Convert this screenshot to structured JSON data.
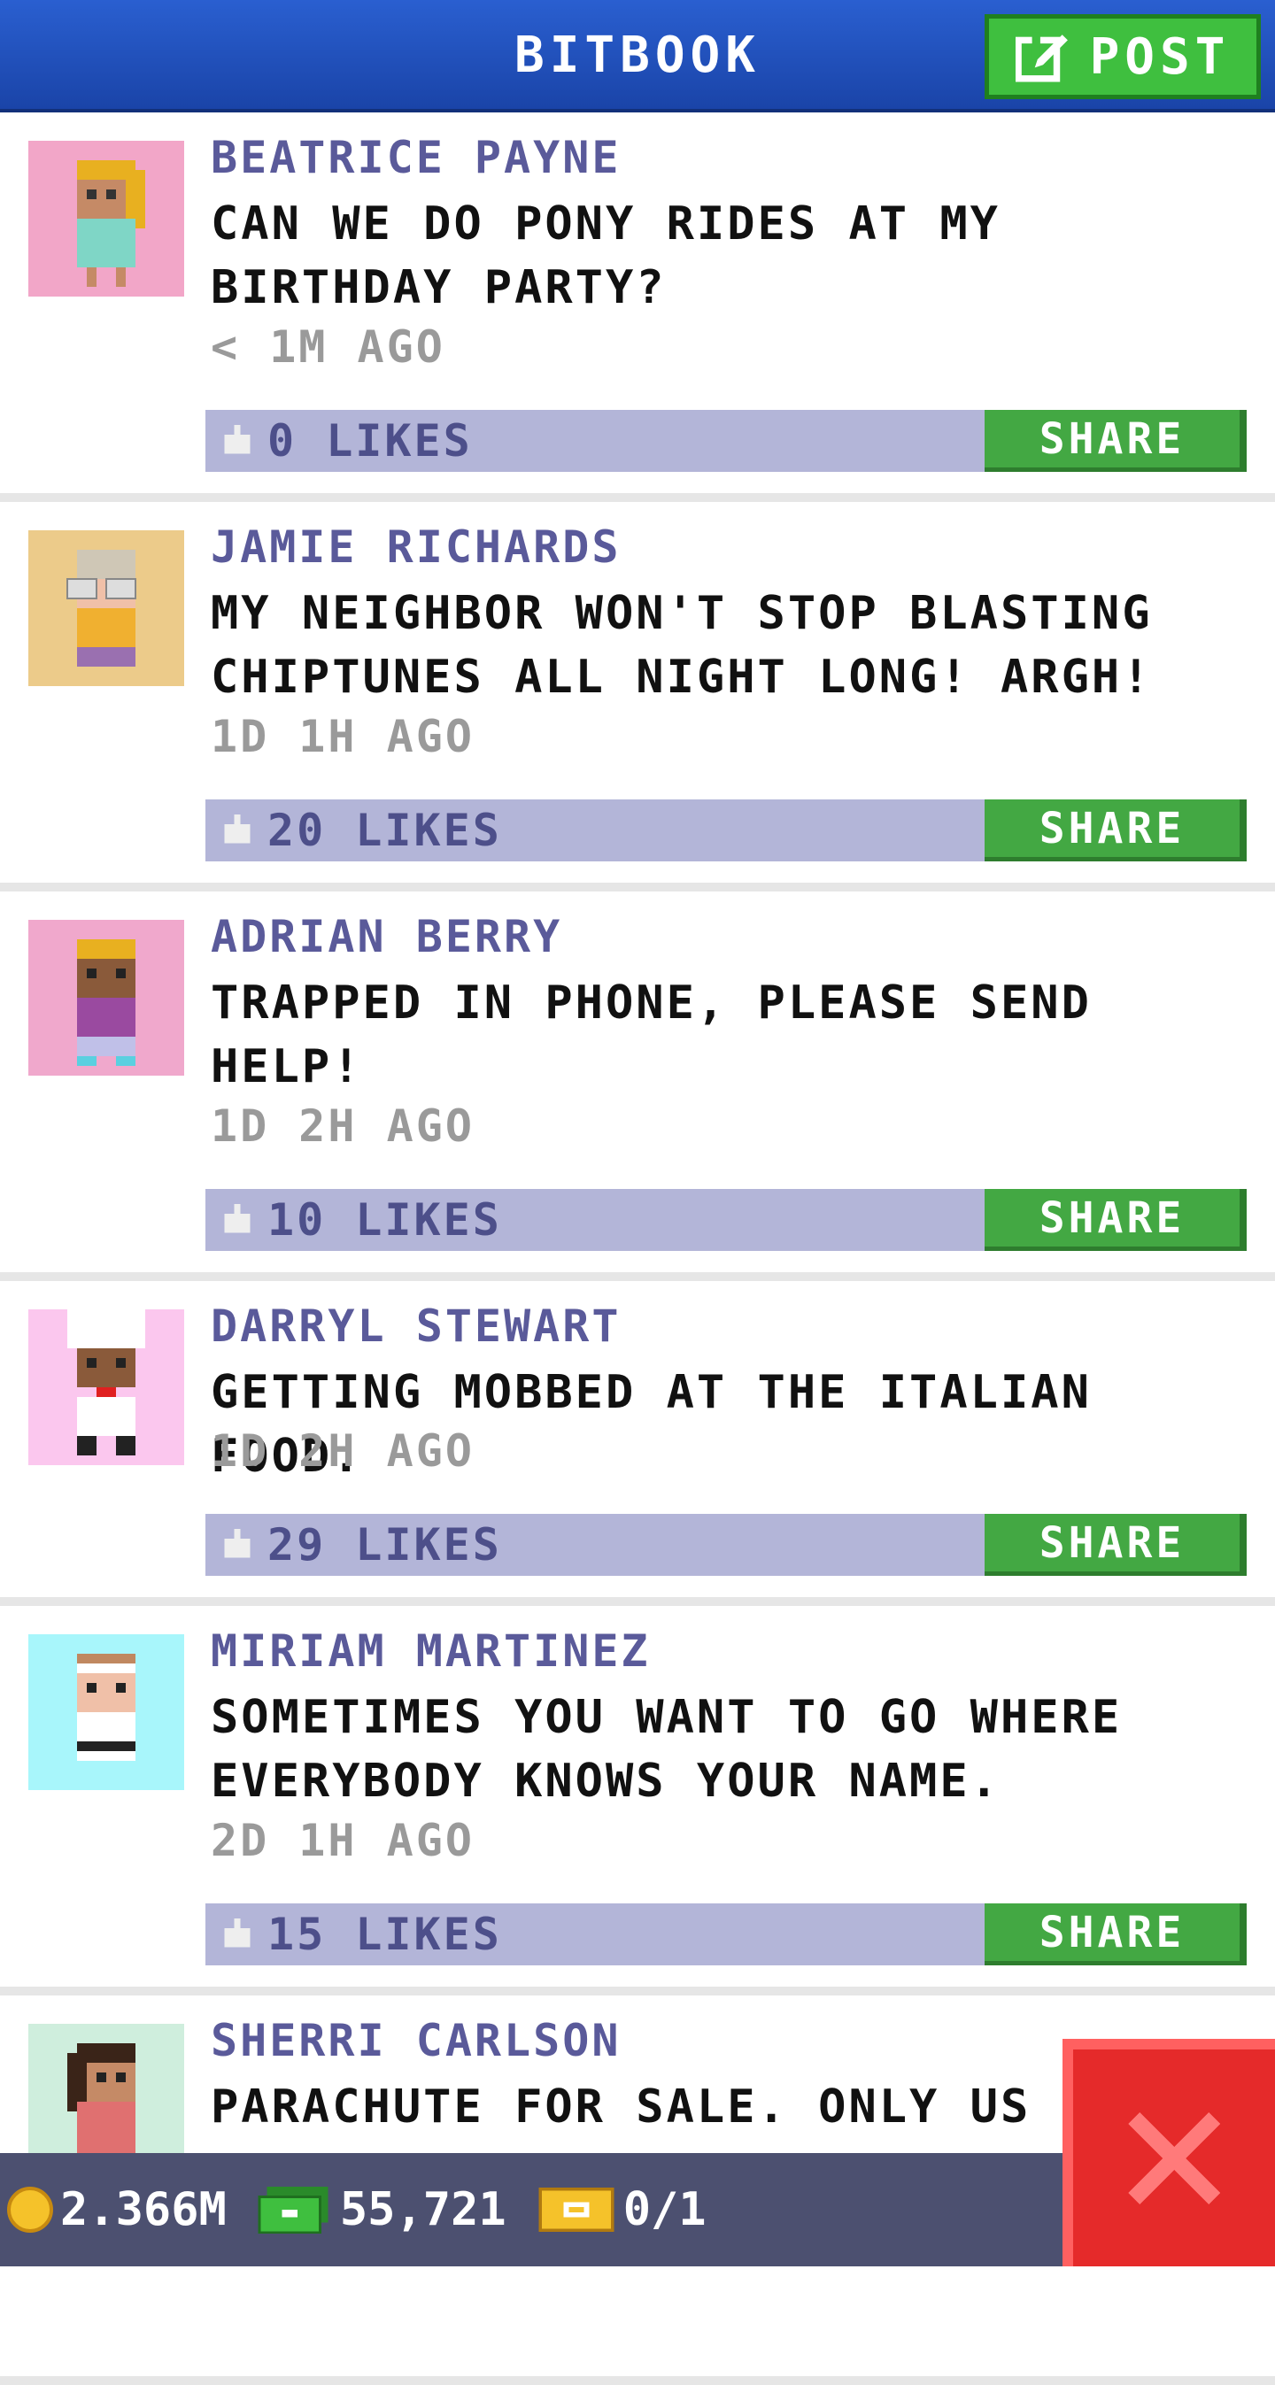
{
  "header": {
    "title": "BITBOOK",
    "post_label": "POST"
  },
  "posts": [
    {
      "name": "BEATRICE PAYNE",
      "message": "CAN WE DO PONY RIDES AT MY BIRTHDAY PARTY?",
      "time": "< 1M AGO",
      "likes": "0 LIKES",
      "share": "SHARE",
      "avatar_bg": "#f2a6c8"
    },
    {
      "name": "JAMIE RICHARDS",
      "message": "MY NEIGHBOR WON'T STOP BLASTING CHIPTUNES ALL NIGHT LONG! ARGH!",
      "time": "1D 1H AGO",
      "likes": "20 LIKES",
      "share": "SHARE",
      "avatar_bg": "#eccb8a"
    },
    {
      "name": "ADRIAN BERRY",
      "message": "TRAPPED IN PHONE, PLEASE SEND HELP!",
      "time": "1D 2H AGO",
      "likes": "10 LIKES",
      "share": "SHARE",
      "avatar_bg": "#f0a8cc"
    },
    {
      "name": "DARRYL STEWART",
      "message": "GETTING MOBBED AT THE ITALIAN FOOD.",
      "time": "1D 2H AGO",
      "likes": "29 LIKES",
      "share": "SHARE",
      "avatar_bg": "#fbc7ee"
    },
    {
      "name": "MIRIAM MARTINEZ",
      "message": "SOMETIMES YOU WANT TO GO WHERE EVERYBODY KNOWS YOUR NAME.",
      "time": "2D 1H AGO",
      "likes": "15 LIKES",
      "share": "SHARE",
      "avatar_bg": "#a8f6fb"
    },
    {
      "name": "SHERRI CARLSON",
      "message": "PARACHUTE FOR SALE. ONLY US",
      "avatar_bg": "#cfeedd"
    }
  ],
  "footer": {
    "coins": "2.366M",
    "bux": "55,721",
    "tickets": "0/1"
  },
  "colors": {
    "header_blue": "#1f4fbf",
    "share_green": "#43a843",
    "likes_bar": "#b3b5d8",
    "close_red": "#e52a2a"
  },
  "icons": {
    "post": "edit-icon",
    "like": "thumbs-up-icon",
    "close": "close-icon",
    "coin": "coin-icon",
    "bux": "cash-icon",
    "ticket": "ticket-icon"
  }
}
